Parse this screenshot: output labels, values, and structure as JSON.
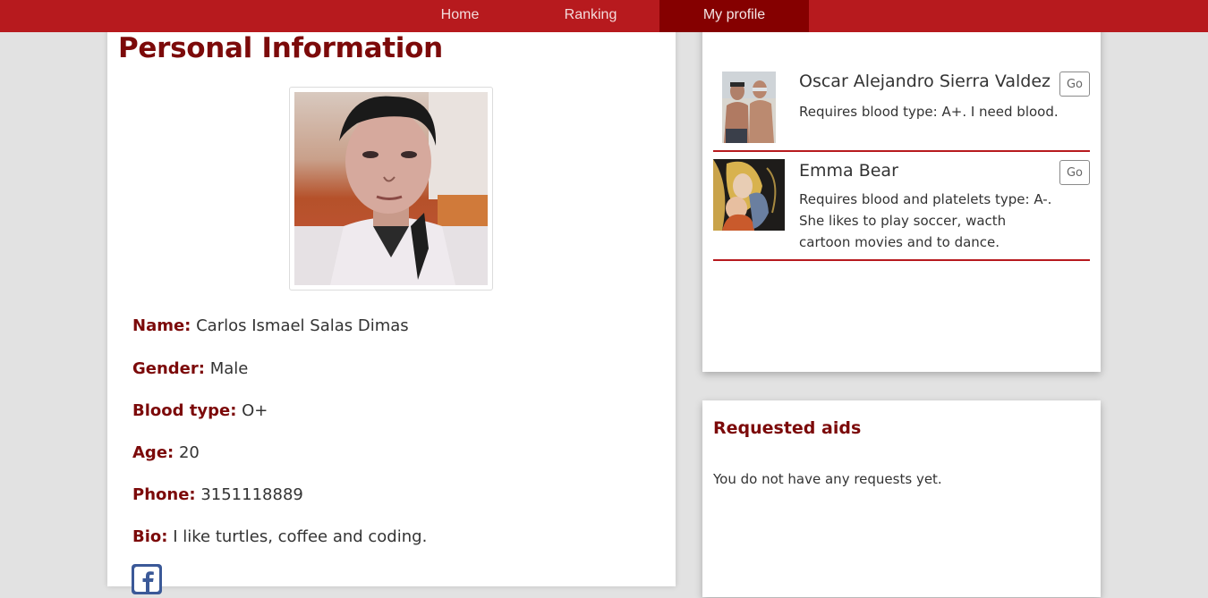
{
  "nav": {
    "items": [
      {
        "label": "Home",
        "active": false
      },
      {
        "label": "Ranking",
        "active": false
      },
      {
        "label": "My profile",
        "active": true
      }
    ]
  },
  "profile": {
    "title": "Personal Information",
    "photo_icon": "profile-photo",
    "fields": [
      {
        "label": "Name:",
        "value": "Carlos Ismael Salas Dimas"
      },
      {
        "label": "Gender:",
        "value": "Male"
      },
      {
        "label": "Blood type:",
        "value": "O+"
      },
      {
        "label": "Age:",
        "value": "20"
      },
      {
        "label": "Phone:",
        "value": "3151118889"
      },
      {
        "label": "Bio:",
        "value": "I like turtles, coffee and coding."
      }
    ],
    "social_icon": "facebook-icon"
  },
  "aids": {
    "items": [
      {
        "name": "Oscar Alejandro Sierra Valdez",
        "description": "Requires blood type: A+. I need blood.",
        "button": "Go"
      },
      {
        "name": "Emma Bear",
        "description": "Requires blood and platelets type: A-. She likes to play soccer, wacth cartoon movies and to dance.",
        "button": "Go"
      }
    ]
  },
  "requested": {
    "title": "Requested aids",
    "empty_message": "You do not have any requests yet."
  },
  "colors": {
    "nav_bg": "#b71a1e",
    "nav_active_bg": "#850000",
    "accent_text": "#7c0a0a",
    "page_bg": "#e2e2e2",
    "facebook": "#3b5998"
  }
}
